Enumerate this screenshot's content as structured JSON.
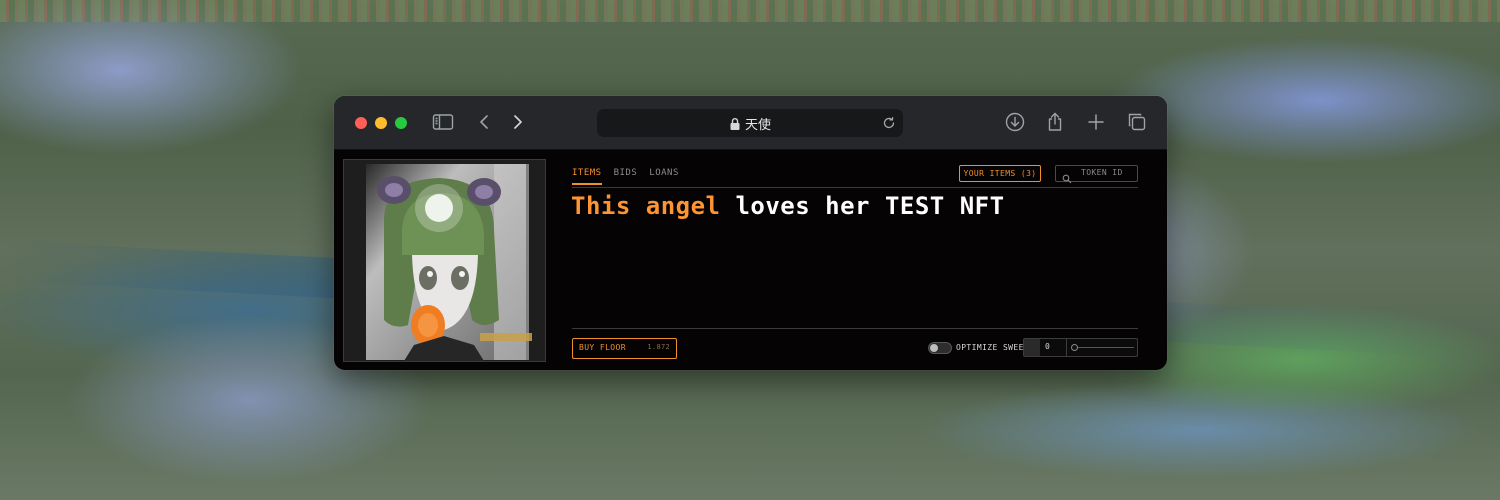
{
  "browser": {
    "url": "天使",
    "icons": [
      "sidebar-icon",
      "back-icon",
      "forward-icon",
      "lock-icon",
      "reload-icon",
      "download-icon",
      "share-icon",
      "new-tab-icon",
      "tabs-overview-icon"
    ]
  },
  "tabs": [
    {
      "label": "ITEMS",
      "active": true
    },
    {
      "label": "BIDS",
      "active": false
    },
    {
      "label": "LOANS",
      "active": false
    }
  ],
  "your_items_label": "YOUR ITEMS (3)",
  "token_search_placeholder": "TOKEN ID",
  "headline": {
    "highlight": "This angel",
    "rest": " loves her TEST NFT"
  },
  "buy_floor": {
    "label": "BUY FLOOR",
    "price": "1.872"
  },
  "optimize_sweep_label": "OPTIMIZE SWEEP",
  "sweep_count": "0",
  "colors": {
    "accent": "#f0902a",
    "headline_highlight": "#ff9433",
    "window_bg": "#050304",
    "titlebar_bg": "#25272a"
  }
}
